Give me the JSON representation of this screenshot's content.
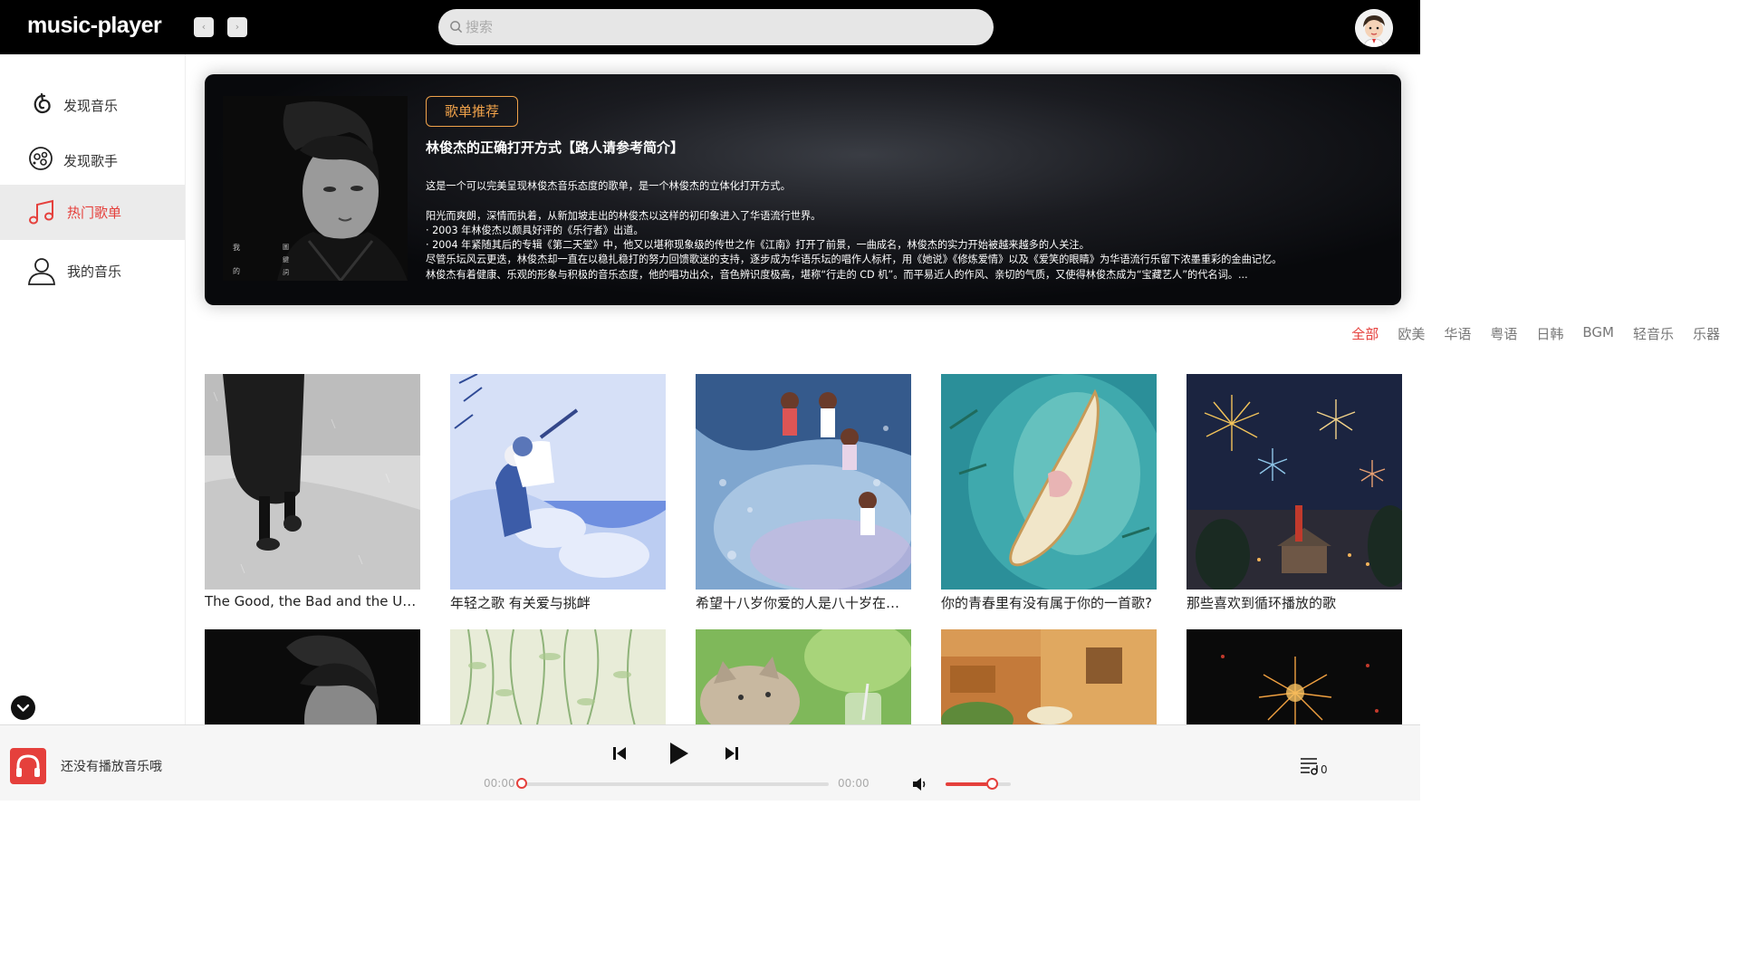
{
  "app": {
    "title": "music-player"
  },
  "header": {
    "search_placeholder": "搜索",
    "back_icon": "chevron-left-icon",
    "forward_icon": "chevron-right-icon"
  },
  "sidebar": {
    "items": [
      {
        "label": "发现音乐",
        "icon": "netease-music-icon",
        "active": false
      },
      {
        "label": "发现歌手",
        "icon": "singer-icon",
        "active": false
      },
      {
        "label": "热门歌单",
        "icon": "music-note-icon",
        "active": true
      },
      {
        "label": "我的音乐",
        "icon": "user-icon",
        "active": false
      }
    ]
  },
  "banner": {
    "tag": "歌单推荐",
    "title": "林俊杰的正确打开方式【路人请参考简介】",
    "description": "这是一个可以完美呈现林俊杰音乐态度的歌单，是一个林俊杰的立体化打开方式。\n\n阳光而爽朗，深情而执着，从新加坡走出的林俊杰以这样的初印象进入了华语流行世界。\n· 2003 年林俊杰以颇具好评的《乐行者》出道。\n· 2004 年紧随其后的专辑《第二天堂》中，他又以堪称现象级的传世之作《江南》打开了前景，一曲成名，林俊杰的实力开始被越来越多的人关注。\n尽管乐坛风云更迭，林俊杰却一直在以稳扎稳打的努力回馈歌迷的支持，逐步成为华语乐坛的唱作人标杆，用《她说》《修炼爱情》以及《爱笑的眼睛》为华语流行乐留下浓墨重彩的金曲记忆。\n林俊杰有着健康、乐观的形象与积极的音乐态度，他的唱功出众，音色辨识度极高，堪称“行走的 CD 机”。而平易近人的作风、亲切的气质，又使得林俊杰成为“宝藏艺人”的代名词。...",
    "cover_text": [
      "我",
      "的",
      "圖",
      "鍵",
      "詞"
    ]
  },
  "categories": [
    {
      "label": "全部",
      "active": true
    },
    {
      "label": "欧美",
      "active": false
    },
    {
      "label": "华语",
      "active": false
    },
    {
      "label": "粤语",
      "active": false
    },
    {
      "label": "日韩",
      "active": false
    },
    {
      "label": "BGM",
      "active": false
    },
    {
      "label": "轻音乐",
      "active": false
    },
    {
      "label": "乐器",
      "active": false
    }
  ],
  "playlists": [
    {
      "title": "The Good, the Bad and the Ugly"
    },
    {
      "title": "年轻之歌 有关爱与挑衅"
    },
    {
      "title": "希望十八岁你爱的人是八十岁在你..."
    },
    {
      "title": "你的青春里有没有属于你的一首歌?"
    },
    {
      "title": "那些喜欢到循环播放的歌"
    },
    {
      "title": ""
    },
    {
      "title": ""
    },
    {
      "title": ""
    },
    {
      "title": ""
    },
    {
      "title": ""
    }
  ],
  "player": {
    "now_playing": "还没有播放音乐哦",
    "current_time": "00:00",
    "total_time": "00:00",
    "progress": 0,
    "volume": 0.7,
    "queue_count": "0"
  },
  "colors": {
    "accent": "#e5403c",
    "tag": "#f0a24a",
    "header_bg": "#000000"
  }
}
